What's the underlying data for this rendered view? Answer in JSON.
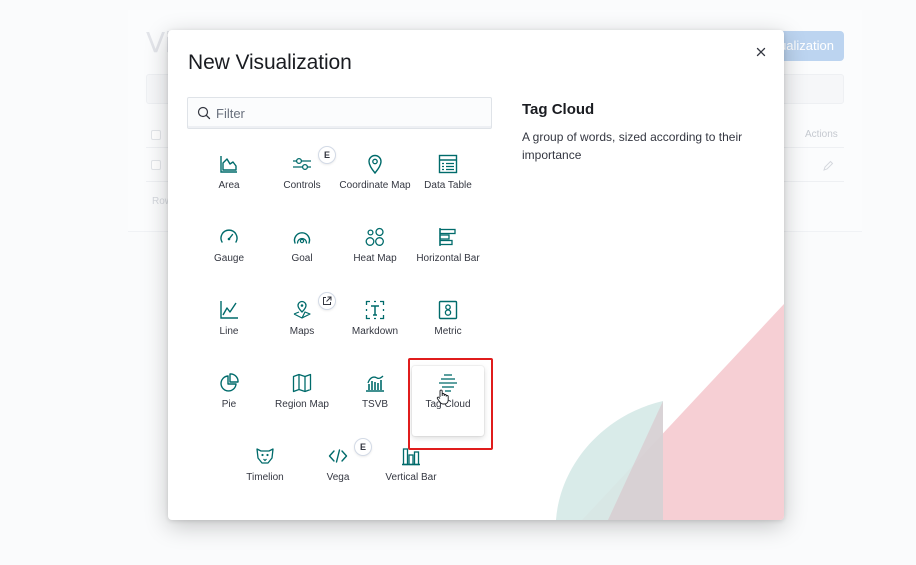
{
  "background": {
    "title": "Vi",
    "create_button_label": "ualization",
    "actions_header": "Actions",
    "rows_label": "Row"
  },
  "modal": {
    "title": "New Visualization",
    "filter": {
      "placeholder": "Filter",
      "value": ""
    },
    "items": [
      {
        "label": "Area",
        "icon": "area-chart-icon"
      },
      {
        "label": "Controls",
        "icon": "controls-icon",
        "badge": "E"
      },
      {
        "label": "Coordinate Map",
        "icon": "map-pin-icon"
      },
      {
        "label": "Data Table",
        "icon": "data-table-icon"
      },
      {
        "label": "Gauge",
        "icon": "gauge-icon"
      },
      {
        "label": "Goal",
        "icon": "goal-icon"
      },
      {
        "label": "Heat Map",
        "icon": "heat-map-icon"
      },
      {
        "label": "Horizontal Bar",
        "icon": "horizontal-bar-icon"
      },
      {
        "label": "Line",
        "icon": "line-chart-icon"
      },
      {
        "label": "Maps",
        "icon": "maps-icon",
        "badge_icon": "external-link-icon"
      },
      {
        "label": "Markdown",
        "icon": "markdown-icon"
      },
      {
        "label": "Metric",
        "icon": "metric-icon"
      },
      {
        "label": "Pie",
        "icon": "pie-chart-icon"
      },
      {
        "label": "Region Map",
        "icon": "region-map-icon"
      },
      {
        "label": "TSVB",
        "icon": "tsvb-icon"
      },
      {
        "label": "Tag Cloud",
        "icon": "tag-cloud-icon",
        "selected": true
      },
      {
        "label": "Timelion",
        "icon": "timelion-icon"
      },
      {
        "label": "Vega",
        "icon": "vega-code-icon",
        "badge": "E"
      },
      {
        "label": "Vertical Bar",
        "icon": "vertical-bar-icon"
      }
    ],
    "selected": {
      "title": "Tag Cloud",
      "description": "A group of words, sized according to their importance"
    }
  },
  "colors": {
    "icon": "#006b6b",
    "highlight": "#e01c1c",
    "decor_pink": "#f4c7cc",
    "decor_teal": "#cfe8e6"
  }
}
